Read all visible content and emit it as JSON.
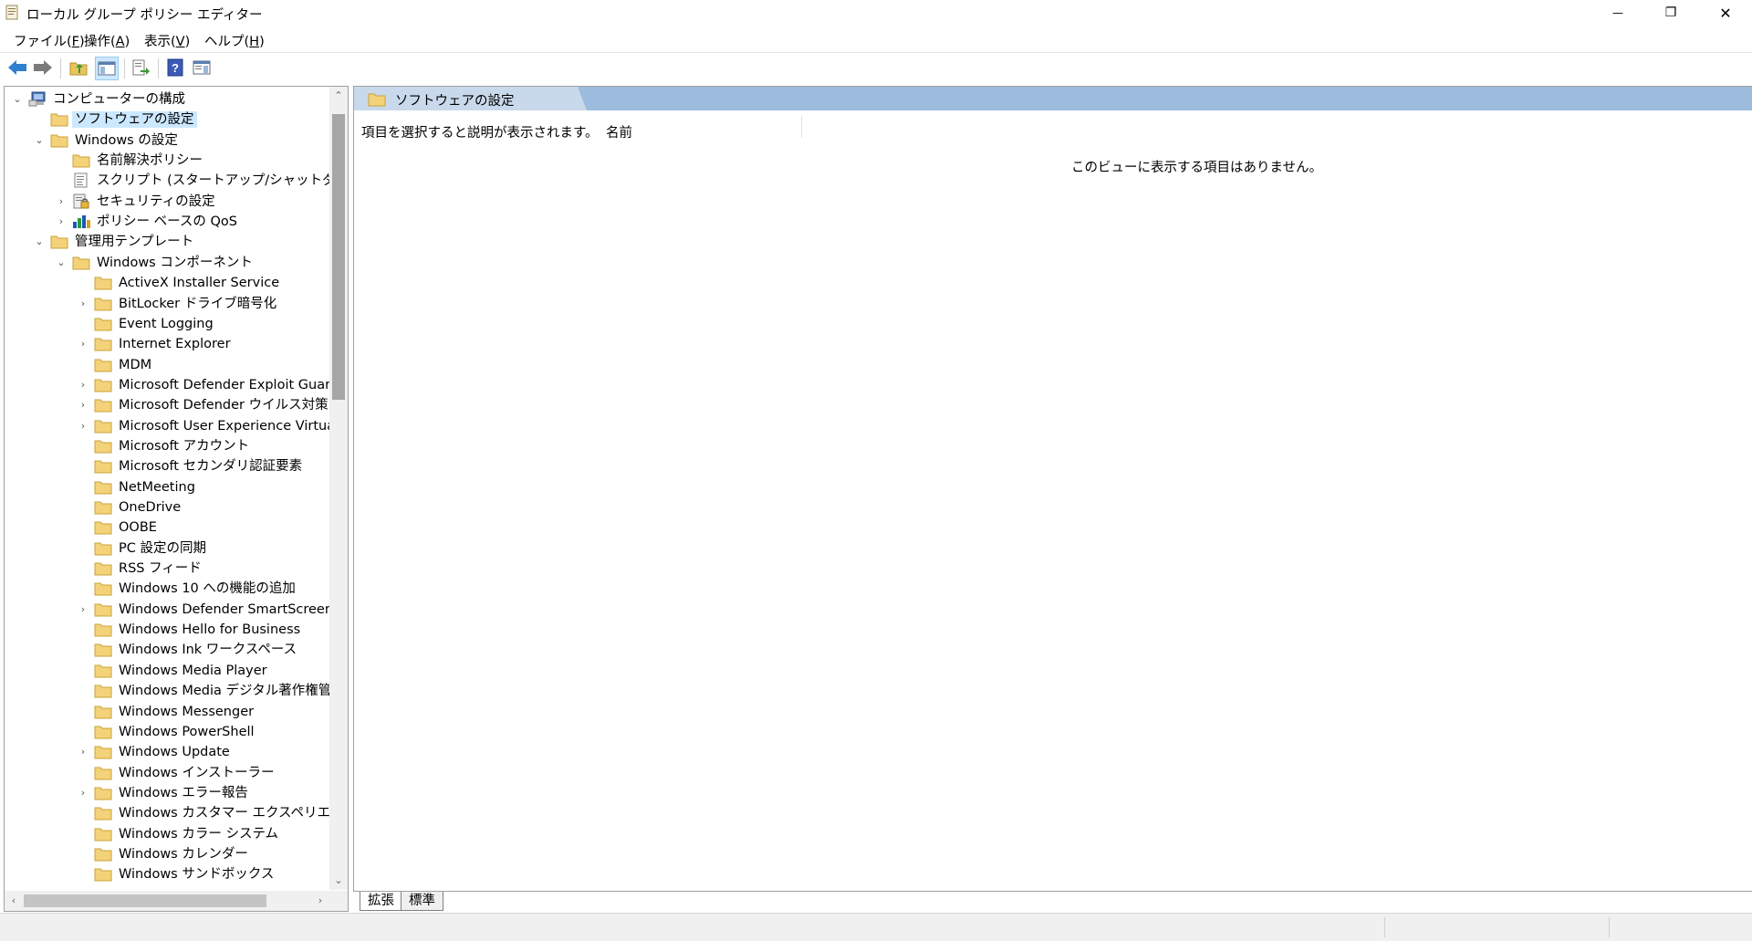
{
  "window": {
    "title": "ローカル グループ ポリシー エディター",
    "minimize_glyph": "—",
    "maximize_glyph": "❐",
    "close_glyph": "✕"
  },
  "menu": [
    {
      "label": "ファイル(",
      "key": "F",
      "suffix": ")"
    },
    {
      "label": "操作(",
      "key": "A",
      "suffix": ")"
    },
    {
      "label": "表示(",
      "key": "V",
      "suffix": ")"
    },
    {
      "label": "ヘルプ(",
      "key": "H",
      "suffix": ")"
    }
  ],
  "toolbar": {
    "icons": [
      "back-arrow-icon",
      "forward-arrow-icon",
      "up-folder-icon",
      "show-hide-tree-icon",
      "export-list-icon",
      "help-icon",
      "show-hide-action-pane-icon"
    ]
  },
  "tree": [
    {
      "label": "コンピューターの構成",
      "expander": "⌄",
      "icon": "computer",
      "selected": false
    },
    {
      "label": "ソフトウェアの設定",
      "expander": "",
      "icon": "folder",
      "selected": true
    },
    {
      "label": "Windows の設定",
      "expander": "⌄",
      "icon": "folder",
      "selected": false
    },
    {
      "label": "名前解決ポリシー",
      "expander": "",
      "icon": "folder",
      "selected": false
    },
    {
      "label": "スクリプト (スタートアップ/シャットダウン)",
      "expander": "",
      "icon": "script",
      "selected": false
    },
    {
      "label": "セキュリティの設定",
      "expander": "›",
      "icon": "security",
      "selected": false
    },
    {
      "label": "ポリシー ベースの QoS",
      "expander": "›",
      "icon": "qos",
      "selected": false
    },
    {
      "label": "管理用テンプレート",
      "expander": "⌄",
      "icon": "folder",
      "selected": false
    },
    {
      "label": "Windows コンポーネント",
      "expander": "⌄",
      "icon": "folder",
      "selected": false
    },
    {
      "label": "ActiveX Installer Service",
      "expander": "",
      "icon": "folder",
      "selected": false
    },
    {
      "label": "BitLocker ドライブ暗号化",
      "expander": "›",
      "icon": "folder",
      "selected": false
    },
    {
      "label": "Event Logging",
      "expander": "",
      "icon": "folder",
      "selected": false
    },
    {
      "label": "Internet Explorer",
      "expander": "›",
      "icon": "folder",
      "selected": false
    },
    {
      "label": "MDM",
      "expander": "",
      "icon": "folder",
      "selected": false
    },
    {
      "label": "Microsoft Defender Exploit Guard",
      "expander": "›",
      "icon": "folder",
      "selected": false
    },
    {
      "label": "Microsoft Defender ウイルス対策",
      "expander": "›",
      "icon": "folder",
      "selected": false
    },
    {
      "label": "Microsoft User Experience Virtualiza",
      "expander": "›",
      "icon": "folder",
      "selected": false
    },
    {
      "label": "Microsoft アカウント",
      "expander": "",
      "icon": "folder",
      "selected": false
    },
    {
      "label": "Microsoft セカンダリ認証要素",
      "expander": "",
      "icon": "folder",
      "selected": false
    },
    {
      "label": "NetMeeting",
      "expander": "",
      "icon": "folder",
      "selected": false
    },
    {
      "label": "OneDrive",
      "expander": "",
      "icon": "folder",
      "selected": false
    },
    {
      "label": "OOBE",
      "expander": "",
      "icon": "folder",
      "selected": false
    },
    {
      "label": "PC 設定の同期",
      "expander": "",
      "icon": "folder",
      "selected": false
    },
    {
      "label": "RSS フィード",
      "expander": "",
      "icon": "folder",
      "selected": false
    },
    {
      "label": "Windows 10 への機能の追加",
      "expander": "",
      "icon": "folder",
      "selected": false
    },
    {
      "label": "Windows Defender SmartScreen",
      "expander": "›",
      "icon": "folder",
      "selected": false
    },
    {
      "label": "Windows Hello for Business",
      "expander": "",
      "icon": "folder",
      "selected": false
    },
    {
      "label": "Windows Ink ワークスペース",
      "expander": "",
      "icon": "folder",
      "selected": false
    },
    {
      "label": "Windows Media Player",
      "expander": "",
      "icon": "folder",
      "selected": false
    },
    {
      "label": "Windows Media デジタル著作権管理",
      "expander": "",
      "icon": "folder",
      "selected": false
    },
    {
      "label": "Windows Messenger",
      "expander": "",
      "icon": "folder",
      "selected": false
    },
    {
      "label": "Windows PowerShell",
      "expander": "",
      "icon": "folder",
      "selected": false
    },
    {
      "label": "Windows Update",
      "expander": "›",
      "icon": "folder",
      "selected": false
    },
    {
      "label": "Windows インストーラー",
      "expander": "",
      "icon": "folder",
      "selected": false
    },
    {
      "label": "Windows エラー報告",
      "expander": "›",
      "icon": "folder",
      "selected": false
    },
    {
      "label": "Windows カスタマー エクスペリエンス向.",
      "expander": "",
      "icon": "folder",
      "selected": false
    },
    {
      "label": "Windows カラー システム",
      "expander": "",
      "icon": "folder",
      "selected": false
    },
    {
      "label": "Windows カレンダー",
      "expander": "",
      "icon": "folder",
      "selected": false
    },
    {
      "label": "Windows サンドボックス",
      "expander": "",
      "icon": "folder",
      "selected": false
    }
  ],
  "scrollbars": {
    "up": "⌃",
    "down": "⌄",
    "left": "‹",
    "right": "›"
  },
  "right_pane": {
    "header_title": "ソフトウェアの設定",
    "description_prompt": "項目を選択すると説明が表示されます。",
    "column_name": "名前",
    "empty_message": "このビューに表示する項目はありません。"
  },
  "tabs": [
    "拡張",
    "標準"
  ],
  "colors": {
    "header_band": "#9dbbdc",
    "selection": "#cce8ff",
    "folder": "#f3d27a"
  }
}
